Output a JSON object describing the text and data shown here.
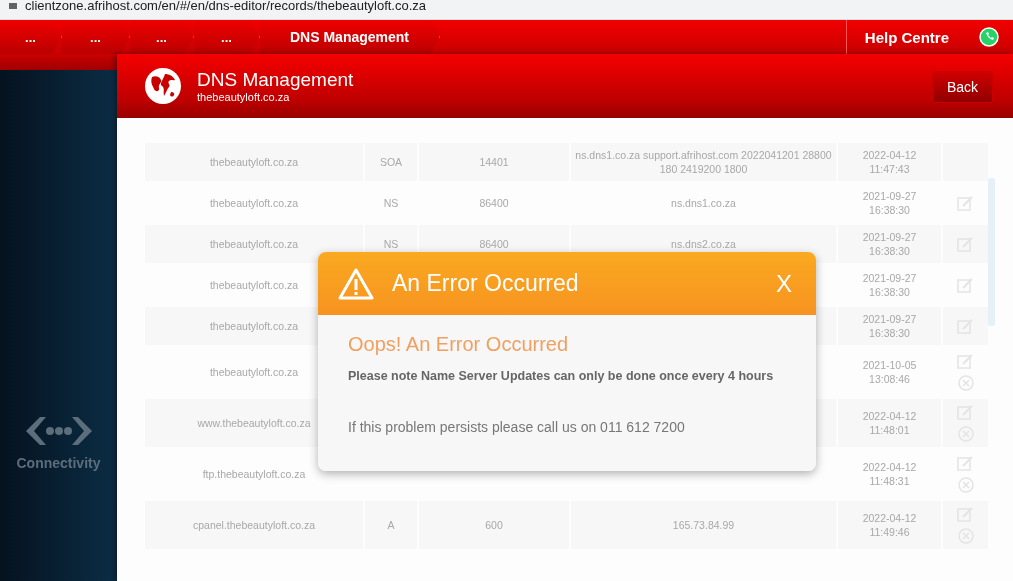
{
  "address_bar": {
    "url": "clientzone.afrihost.com/en/#/en/dns-editor/records/thebeautyloft.co.za"
  },
  "nav": {
    "breadcrumbs": [
      "...",
      "...",
      "...",
      "...",
      "DNS Management"
    ],
    "help": "Help Centre"
  },
  "sidebar": {
    "items": [
      {
        "label": "Connectivity"
      }
    ]
  },
  "panel": {
    "title": "DNS Management",
    "subtitle": "thebeautyloft.co.za",
    "back": "Back"
  },
  "records": [
    {
      "name": "thebeautyloft.co.za",
      "type": "SOA",
      "ttl": "14401",
      "value": "ns.dns1.co.za support.afrihost.com 2022041201 28800 180 2419200 1800",
      "date": "2022-04-12 11:47:43",
      "editable": false,
      "deletable": false
    },
    {
      "name": "thebeautyloft.co.za",
      "type": "NS",
      "ttl": "86400",
      "value": "ns.dns1.co.za",
      "date": "2021-09-27 16:38:30",
      "editable": true,
      "deletable": false
    },
    {
      "name": "thebeautyloft.co.za",
      "type": "NS",
      "ttl": "86400",
      "value": "ns.dns2.co.za",
      "date": "2021-09-27 16:38:30",
      "editable": true,
      "deletable": false
    },
    {
      "name": "thebeautyloft.co.za",
      "date": "2021-09-27 16:38:30",
      "editable": true,
      "deletable": false
    },
    {
      "name": "thebeautyloft.co.za",
      "date": "2021-09-27 16:38:30",
      "editable": true,
      "deletable": false
    },
    {
      "name": "thebeautyloft.co.za",
      "date": "2021-10-05 13:08:46",
      "editable": true,
      "deletable": true
    },
    {
      "name": "www.thebeautyloft.co.za",
      "date": "2022-04-12 11:48:01",
      "editable": true,
      "deletable": true
    },
    {
      "name": "ftp.thebeautyloft.co.za",
      "date": "2022-04-12 11:48:31",
      "editable": true,
      "deletable": true
    },
    {
      "name": "cpanel.thebeautyloft.co.za",
      "type": "A",
      "ttl": "600",
      "value": "165.73.84.99",
      "date": "2022-04-12 11:49:46",
      "editable": true,
      "deletable": true
    }
  ],
  "dialog": {
    "title": "An Error Occurred",
    "close": "X",
    "heading": "Oops! An Error Occurred",
    "message": "Please note Name Server Updates can only be done once every 4 hours",
    "contact": "If this problem persists please call us on 011 612 7200"
  }
}
